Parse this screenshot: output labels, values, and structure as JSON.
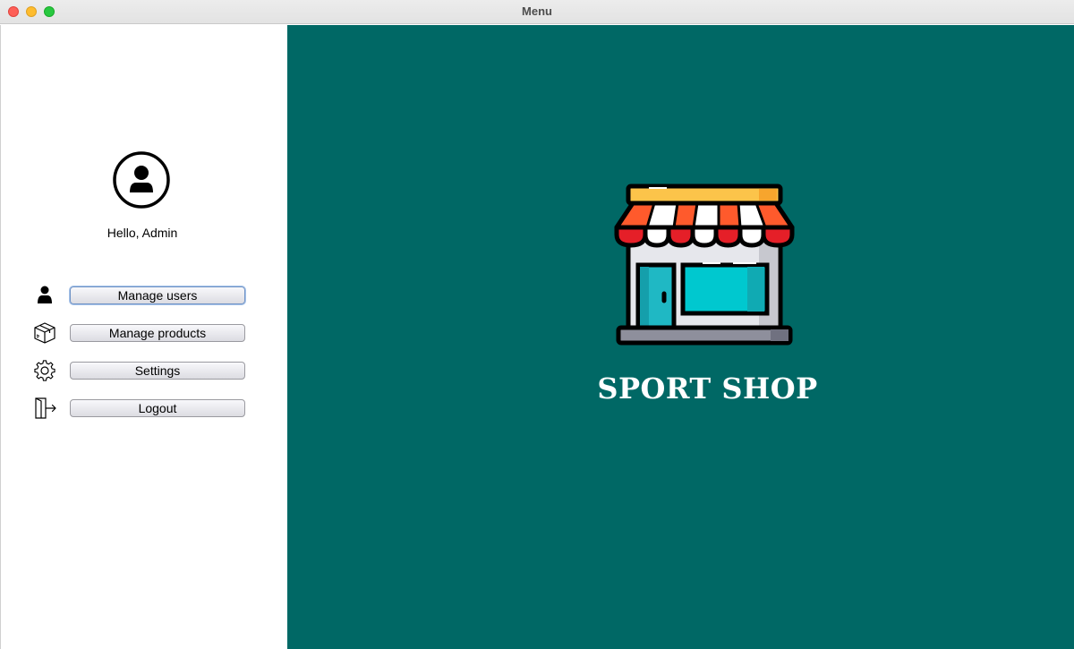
{
  "window": {
    "title": "Menu"
  },
  "sidebar": {
    "avatar_icon": "user-circle-icon",
    "greeting": "Hello, Admin",
    "items": [
      {
        "label": "Manage users",
        "icon": "user-icon",
        "focused": true
      },
      {
        "label": "Manage products",
        "icon": "package-icon",
        "focused": false
      },
      {
        "label": "Settings",
        "icon": "gear-icon",
        "focused": false
      },
      {
        "label": "Logout",
        "icon": "logout-icon",
        "focused": false
      }
    ]
  },
  "main": {
    "logo_icon": "storefront-icon",
    "title": "SPORT SHOP",
    "background_color": "#006865"
  }
}
